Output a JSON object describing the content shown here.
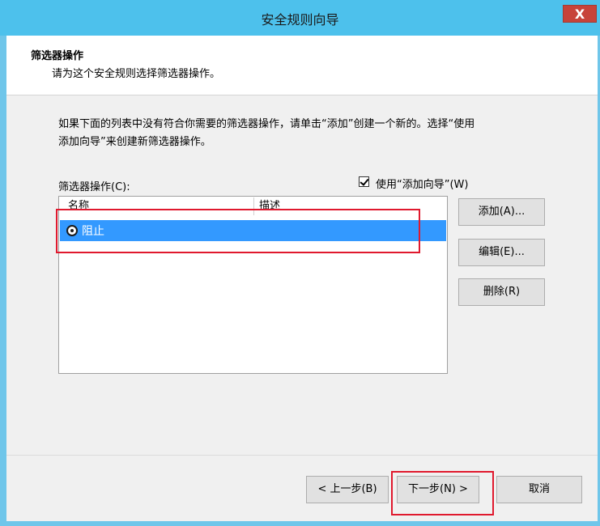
{
  "window": {
    "title": "安全规则向导",
    "close_label": "X",
    "top_fragments": [
      "..",
      "...",
      "..."
    ]
  },
  "header": {
    "title": "筛选器操作",
    "subtitle": "请为这个安全规则选择筛选器操作。"
  },
  "body": {
    "description_line1": "如果下面的列表中没有符合你需要的筛选器操作，请单击“添加”创建一个新的。选择“使用",
    "description_line2": "添加向导”来创建新筛选器操作。",
    "list_label": "筛选器操作(C):",
    "use_wizard_label": "使用“添加向导”(W)",
    "use_wizard_checked": true
  },
  "list": {
    "columns": [
      "名称",
      "描述"
    ],
    "rows": [
      {
        "name": "阻止",
        "description": "",
        "selected": true
      }
    ]
  },
  "side_buttons": {
    "add": "添加(A)...",
    "edit": "编辑(E)...",
    "remove": "删除(R)"
  },
  "footer": {
    "back": "< 上一步(B)",
    "next": "下一步(N) >",
    "cancel": "取消"
  },
  "colors": {
    "titlebar": "#4dc1ec",
    "selection": "#3399ff",
    "highlight_box": "#e0192e",
    "close_button": "#c7433a"
  }
}
